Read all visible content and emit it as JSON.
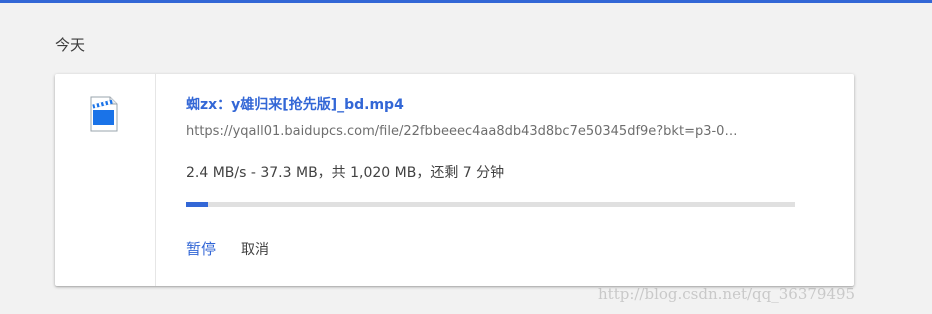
{
  "accent_color": "#3367d6",
  "date_heading": "今天",
  "download": {
    "icon": "video-file-icon",
    "file_name": "蜘zx：y雄归来[抢先版]_bd.mp4",
    "url": "https://yqall01.baidupcs.com/file/22fbbeeec4aa8db43d8bc7e50345df9e?bkt=p3-0…",
    "status": "2.4 MB/s - 37.3 MB，共 1,020 MB，还剩 7 分钟",
    "progress_fraction": 0.0366,
    "pause_label": "暂停",
    "cancel_label": "取消"
  },
  "watermark": "http://blog.csdn.net/qq_36379495"
}
